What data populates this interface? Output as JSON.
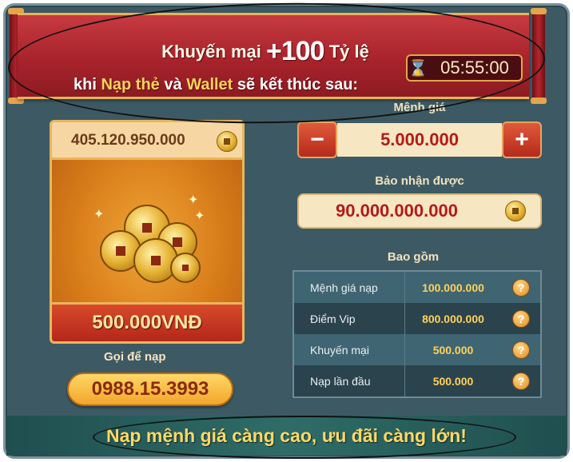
{
  "promo": {
    "line1_prefix": "Khuyến mại",
    "line1_amount": "+100",
    "line1_suffix": "Tỷ lệ",
    "line2_a": "khi",
    "line2_hl1": "Nạp thẻ",
    "line2_b": "và",
    "line2_hl2": "Wallet",
    "line2_c": "sẽ kết thúc sau:",
    "timer": "05:55:00",
    "timer_icon": "hourglass-icon"
  },
  "card": {
    "balance": "405.120.950.000",
    "price": "500.000VNĐ",
    "call_label": "Gọi để nạp",
    "phone": "0988.15.3993"
  },
  "denomination": {
    "label": "Mệnh giá",
    "value": "5.000.000",
    "minus": "−",
    "plus": "+"
  },
  "receive": {
    "label": "Bảo nhận được",
    "value": "90.000.000.000"
  },
  "includes": {
    "label": "Bao gồm",
    "rows": [
      {
        "name": "Mệnh giá nạp",
        "amount": "100.000.000",
        "help": "?"
      },
      {
        "name": "Điểm Vip",
        "amount": "800.000.000",
        "help": "?"
      },
      {
        "name": "Khuyến mại",
        "amount": "500.000",
        "help": "?"
      },
      {
        "name": "Nạp lần đầu",
        "amount": "500.000",
        "help": "?"
      }
    ]
  },
  "footer": "Nạp mệnh giá càng cao, ưu đãi càng lớn!",
  "colors": {
    "background": "#3d5a64",
    "banner": "#a8232b",
    "accent_gold": "#ffd35c",
    "value_red": "#b31a1a"
  }
}
